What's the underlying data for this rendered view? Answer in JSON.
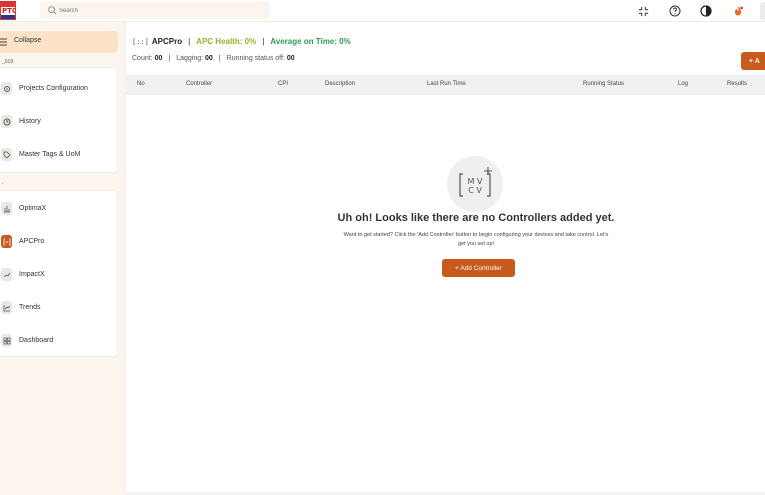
{
  "topbar": {
    "search_placeholder": "Search",
    "icons": [
      "collapse-arrows-icon",
      "help-icon",
      "contrast-icon",
      "flame-icon"
    ]
  },
  "sidebar": {
    "collapse_label": "Collapse",
    "project_id": "_019",
    "section_mark": ".",
    "items": [
      {
        "label": "Projects Configuration",
        "icon": "config-icon"
      },
      {
        "label": "History",
        "icon": "history-icon"
      },
      {
        "label": "Master Tags & UoM",
        "icon": "tag-icon"
      },
      {
        "label": "OptimaX",
        "icon": "optimax-icon"
      },
      {
        "label": "APCPro",
        "icon": "apcpro-icon",
        "active": true
      },
      {
        "label": "ImpactX",
        "icon": "impactx-icon"
      },
      {
        "label": "Trends",
        "icon": "trends-icon"
      },
      {
        "label": "Dashboard",
        "icon": "dashboard-icon"
      }
    ]
  },
  "header": {
    "app_name": "APCPro",
    "health": "APC Health: 0%",
    "on_time": "Average on Time: 0%",
    "count_label": "Count:",
    "count_value": "00",
    "lagging_label": "Lagging:",
    "lagging_value": "00",
    "running_off_label": "Running status off:",
    "running_off_value": "00",
    "add_button_label": "+ A"
  },
  "table": {
    "columns": [
      "No",
      "Controller",
      "CPI",
      "Description",
      "Last Run Time",
      "Running Status",
      "Log",
      "Results"
    ]
  },
  "empty_state": {
    "icon_text": "MV CV",
    "title": "Uh oh! Looks like there are no Controllers added yet.",
    "description": "Want to get started? Click the 'Add Controller' button to begin configuring your devices and take control. Let's get you set up!",
    "button_label": "+ Add Controller"
  },
  "colors": {
    "accent": "#c85a1e",
    "health": "#9ab030",
    "on_time": "#2e9c56",
    "sidebar_bg": "#fbf5ee",
    "collapse_bg": "#fbe2c9"
  }
}
